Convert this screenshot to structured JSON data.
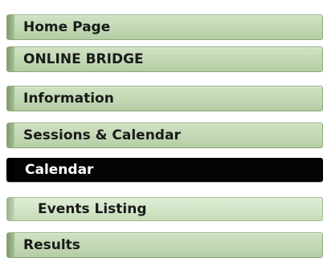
{
  "menu": {
    "items": [
      {
        "label": "Home Page"
      },
      {
        "label": "ONLINE BRIDGE"
      },
      {
        "label": "Information"
      },
      {
        "label": "Sessions & Calendar"
      }
    ],
    "submenu": {
      "items": [
        {
          "label": "Calendar",
          "active": true
        },
        {
          "label": "Events Listing",
          "active": false
        }
      ]
    },
    "more_items": [
      {
        "label": "Results"
      }
    ]
  }
}
